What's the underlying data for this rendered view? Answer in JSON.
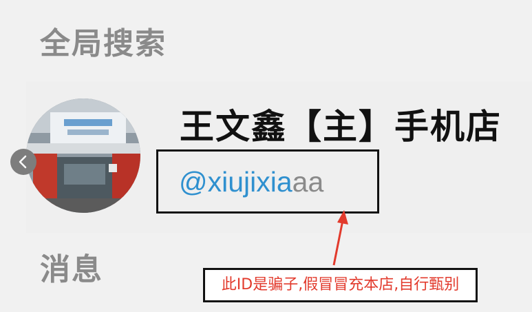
{
  "sections": {
    "global_search": "全局搜索",
    "messages": "消息"
  },
  "result": {
    "shop_name": "王文鑫【主】手机店",
    "handle_main": "@xiujixia",
    "handle_tail": "aa"
  },
  "annotation": {
    "warning": "此ID是骗子,假冒冒充本店,自行甄别"
  },
  "icons": {
    "prev": "chevron-left-icon"
  },
  "colors": {
    "handle_blue": "#2f90cf",
    "warning_red": "#e23a2c"
  }
}
